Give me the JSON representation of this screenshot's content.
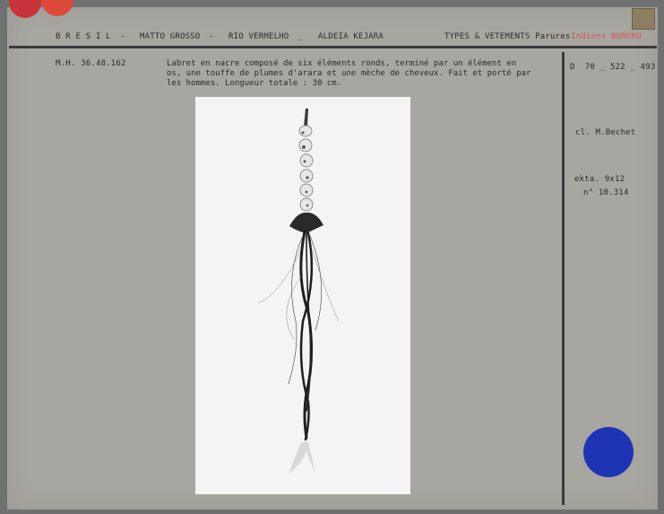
{
  "header": {
    "country": "B R E S I L",
    "dash1": "-",
    "region": "MATTO GROSSO",
    "dash2": "-",
    "river": "RIO VERMELHO",
    "dash3": "_",
    "village": "ALDEIA KEJARA",
    "category": "TYPES & VETEMENTS Parures",
    "people": "Indiens BORORO"
  },
  "record": {
    "inventory_number": "M.H. 36.48.162",
    "description": "Labret en nacre composé de six éléments ronds, terminé par un élément en os, une touffe de plumes d'arara et une mèche de cheveux. Fait et porté par les hommes. Longueur totale : 30 cm."
  },
  "side": {
    "reference": "D  70 _ 522 _ 493",
    "photographer": "cl. M.Bechet",
    "format": "ekta. 9x12",
    "number": "n° 10.314"
  },
  "colors": {
    "card": "#a7a6a0",
    "background": "#6f7170",
    "red_accent": "#d6545a",
    "blue_dot": "#1d35b5",
    "red_dot": "#c8343a"
  }
}
